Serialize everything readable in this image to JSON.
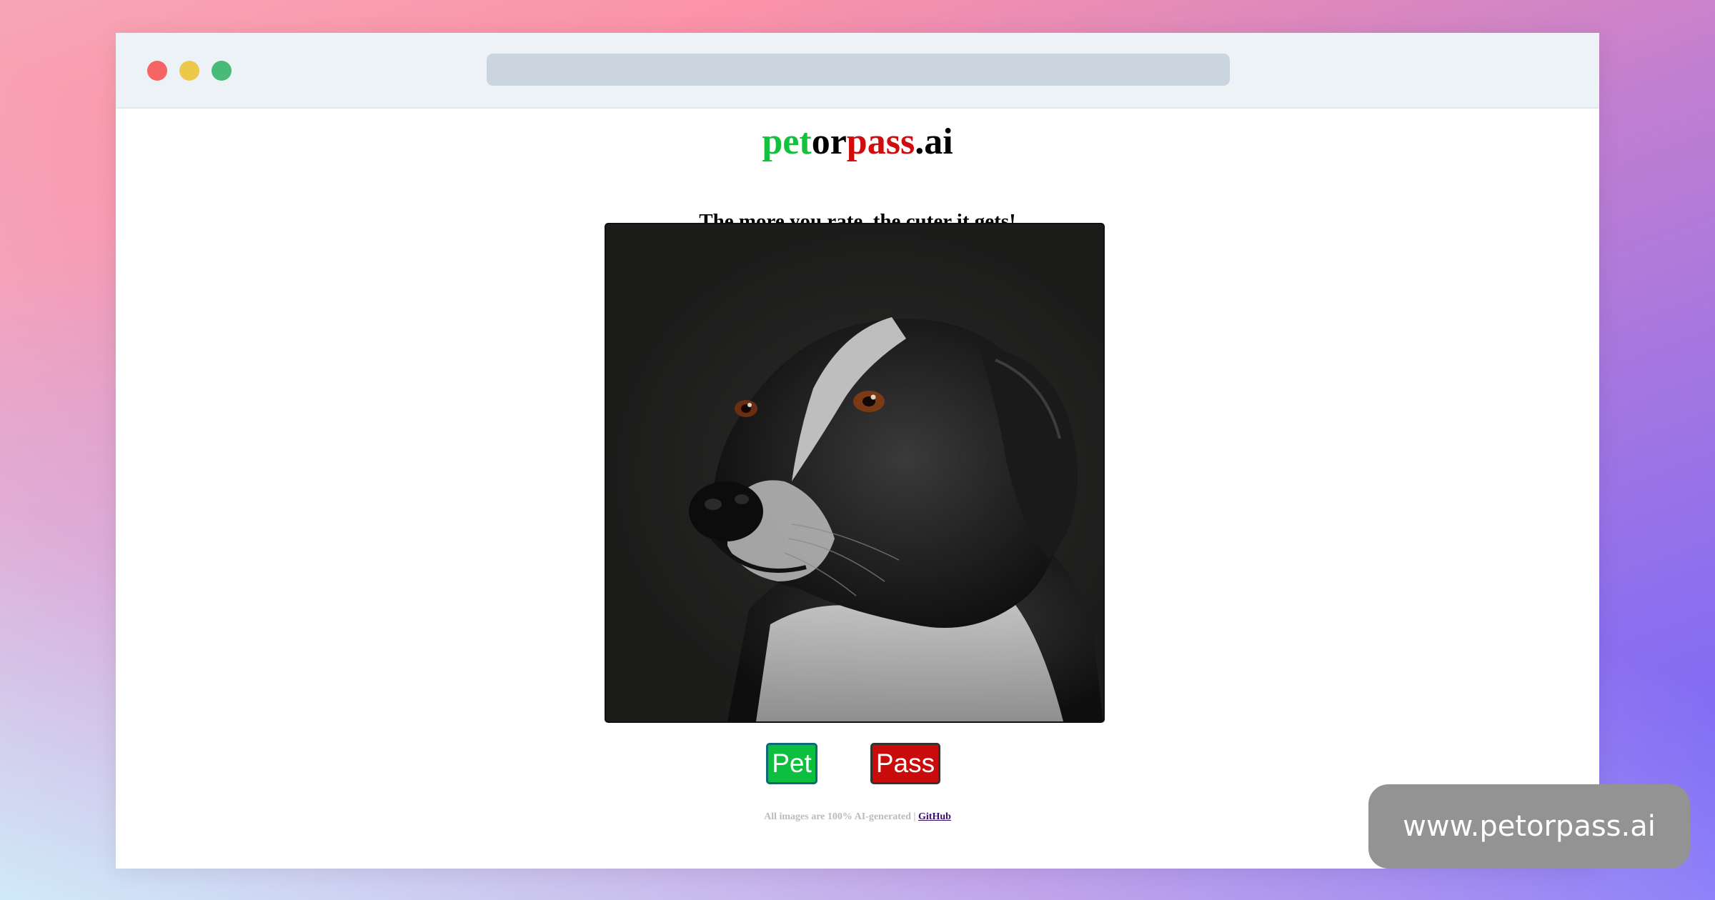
{
  "site": {
    "logo": {
      "pet": "pet",
      "or": "or",
      "pass": "pass",
      "ai": ".ai"
    },
    "tagline": "The more you rate, the cuter it gets!"
  },
  "image": {
    "subject_icon": "dog-portrait-image"
  },
  "actions": {
    "pet_label": "Pet",
    "pass_label": "Pass"
  },
  "footer": {
    "text": "All images are 100% AI-generated | ",
    "link_label": "GitHub"
  },
  "badge": {
    "text": "www.petorpass.ai"
  },
  "colors": {
    "pet_green": "#13c13d",
    "pass_red": "#d10c0c",
    "pet_button": "#0dbf3f",
    "pass_button": "#c90b0b"
  }
}
